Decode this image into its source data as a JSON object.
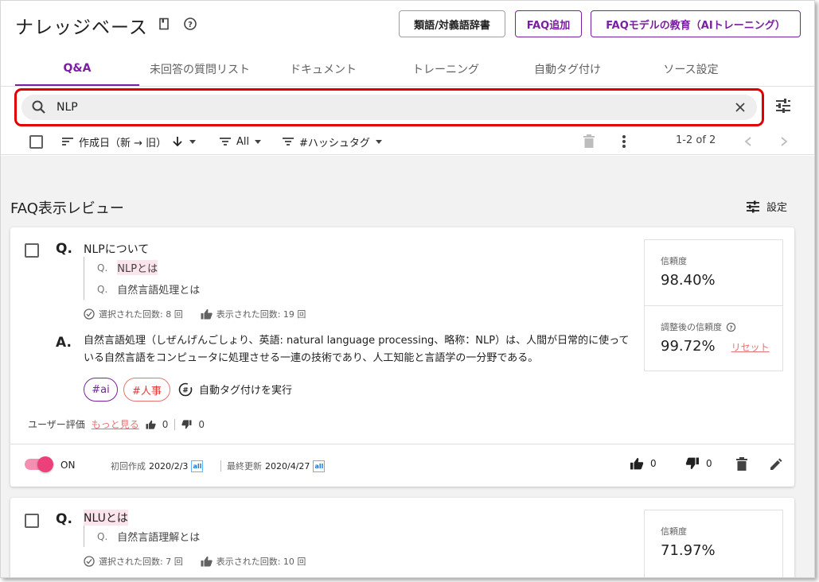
{
  "header": {
    "title": "ナレッジベース",
    "btn_dict": "類語/対義語辞書",
    "btn_add_faq": "FAQ追加",
    "btn_train": "FAQモデルの教育（AIトレーニング）"
  },
  "tabs": [
    "Q&A",
    "未回答の質問リスト",
    "ドキュメント",
    "トレーニング",
    "自動タグ付け",
    "ソース設定"
  ],
  "search": {
    "value": "NLP"
  },
  "toolbar": {
    "sort_label": "作成日（新 → 旧）",
    "filter_all": "All",
    "filter_hashtag": "#ハッシュタグ",
    "pager": "1-2 of 2"
  },
  "review": {
    "title": "FAQ表示レビュー",
    "settings_label": "設定"
  },
  "card1": {
    "q_mark": "Q.",
    "a_mark": "A.",
    "question": "NLPについて",
    "sub_questions": [
      {
        "mark": "Q.",
        "text": "NLPとは"
      },
      {
        "mark": "Q.",
        "text": "自然言語処理とは"
      }
    ],
    "selected_count": "選択された回数: 8 回",
    "displayed_count": "表示された回数: 19 回",
    "answer": "自然言語処理（しぜんげんごしょり、英語: natural language processing、略称：NLP）は、人間が日常的に使っている自然言語をコンピュータに処理させる一連の技術であり、人工知能と言語学の一分野である。",
    "tags": [
      "#ai",
      "#人事"
    ],
    "auto_tag": "自動タグ付けを実行",
    "user_rating_label": "ユーザー評価",
    "more_link": "もっと見る",
    "likes": "0",
    "dislikes": "0",
    "confidence_label": "信頼度",
    "confidence": "98.40%",
    "adjusted_label": "調整後の信頼度",
    "adjusted": "99.72%",
    "reset": "リセット",
    "toggle_label": "ON",
    "created_label": "初回作成",
    "created": "2020/2/3",
    "updated_label": "最終更新",
    "updated": "2020/4/27",
    "badge": "all",
    "footer_likes": "0",
    "footer_dislikes": "0"
  },
  "card2": {
    "q_mark": "Q.",
    "question": "NLUとは",
    "sub_questions": [
      {
        "mark": "Q.",
        "text": "自然言語理解とは"
      }
    ],
    "selected_count": "選択された回数: 7 回",
    "displayed_count": "表示された回数: 10 回",
    "confidence_label": "信頼度",
    "confidence": "71.97%"
  },
  "colors": {
    "accent": "#7b1fa2",
    "highlight_red": "#e00000",
    "pink": "#ec407a"
  }
}
